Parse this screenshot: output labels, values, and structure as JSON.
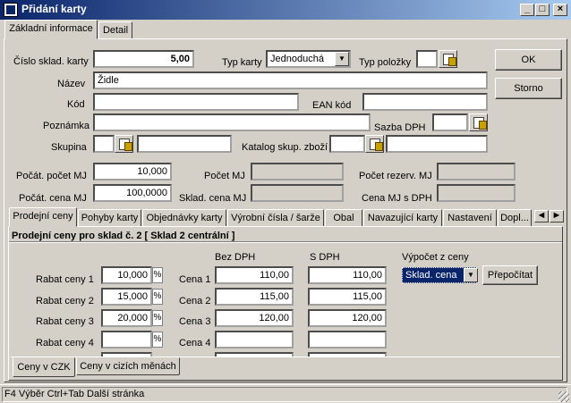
{
  "window": {
    "title": "Přidání karty",
    "min": "_",
    "max": "□",
    "close": "×"
  },
  "tabs_top": [
    "Základní informace",
    "Detail"
  ],
  "form": {
    "cislo_label": "Číslo sklad. karty",
    "cislo_value": "5,00",
    "typ_karty_label": "Typ karty",
    "typ_karty_value": "Jednoduchá",
    "typ_polozky_label": "Typ položky",
    "nazev_label": "Název",
    "nazev_value": "Židle",
    "kod_label": "Kód",
    "ean_label": "EAN kód",
    "poznamka_label": "Poznámka",
    "sazba_label": "Sazba DPH",
    "skupina_label": "Skupina",
    "katalog_label": "Katalog skup. zboží",
    "pocat_pocet_label": "Počát. počet MJ",
    "pocat_pocet_value": "10,000",
    "pocet_mj_label": "Počet MJ",
    "pocet_rezerv_label": "Počet rezerv. MJ",
    "pocat_cena_label": "Počát. cena MJ",
    "pocat_cena_value": "100,0000",
    "sklad_cena_label": "Sklad. cena MJ",
    "cena_sdph_label": "Cena MJ s DPH"
  },
  "buttons": {
    "ok": "OK",
    "storno": "Storno",
    "prepocitat": "Přepočítat"
  },
  "tabs_mid": [
    "Prodejní ceny",
    "Pohyby karty",
    "Objednávky karty",
    "Výrobní čísla / šarže",
    "Obal",
    "Navazující karty",
    "Nastavení",
    "Dopl..."
  ],
  "prices": {
    "heading": "Prodejní ceny pro sklad č. 2 [ Sklad 2 centrální ]",
    "bez_dph_label": "Bez DPH",
    "s_dph_label": "S DPH",
    "vypocet_label": "Výpočet z ceny",
    "vypocet_value": "Sklad. cena",
    "pct_sign": "%",
    "rows": [
      {
        "rabat_label": "Rabat ceny 1",
        "rabat": "10,000",
        "cena_label": "Cena 1",
        "bez": "110,00",
        "s": "110,00"
      },
      {
        "rabat_label": "Rabat ceny 2",
        "rabat": "15,000",
        "cena_label": "Cena 2",
        "bez": "115,00",
        "s": "115,00"
      },
      {
        "rabat_label": "Rabat ceny 3",
        "rabat": "20,000",
        "cena_label": "Cena 3",
        "bez": "120,00",
        "s": "120,00"
      },
      {
        "rabat_label": "Rabat ceny 4",
        "rabat": "",
        "cena_label": "Cena 4",
        "bez": "",
        "s": ""
      }
    ]
  },
  "tabs_bottom": [
    "Ceny v CZK",
    "Ceny v cizích měnách"
  ],
  "status": "F4 Výběr  Ctrl+Tab Další stránka"
}
